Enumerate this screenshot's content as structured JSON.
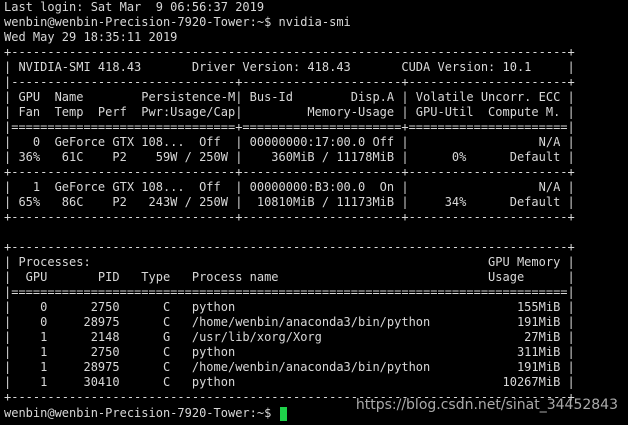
{
  "terminal": {
    "lines": [
      "Last login: Sat Mar  9 06:56:37 2019",
      "wenbin@wenbin-Precision-7920-Tower:~$ nvidia-smi",
      "Wed May 29 18:35:11 2019",
      "+-----------------------------------------------------------------------------+",
      "| NVIDIA-SMI 418.43       Driver Version: 418.43       CUDA Version: 10.1     |",
      "|-------------------------------+----------------------+----------------------+",
      "| GPU  Name        Persistence-M| Bus-Id        Disp.A | Volatile Uncorr. ECC |",
      "| Fan  Temp  Perf  Pwr:Usage/Cap|         Memory-Usage | GPU-Util  Compute M. |",
      "|===============================+======================+======================|",
      "|   0  GeForce GTX 108...  Off  | 00000000:17:00.0 Off |                  N/A |",
      "| 36%   61C    P2    59W / 250W |    360MiB / 11178MiB |      0%      Default |",
      "+-------------------------------+----------------------+----------------------+",
      "|   1  GeForce GTX 108...  Off  | 00000000:B3:00.0  On |                  N/A |",
      "| 65%   86C    P2   243W / 250W |  10810MiB / 11173MiB |     34%      Default |",
      "+-------------------------------+----------------------+----------------------+",
      "",
      "+-----------------------------------------------------------------------------+",
      "| Processes:                                                       GPU Memory |",
      "|  GPU       PID   Type   Process name                             Usage      |",
      "|=============================================================================|",
      "|    0      2750      C   python                                       155MiB |",
      "|    0     28975      C   /home/wenbin/anaconda3/bin/python            191MiB |",
      "|    1      2148      G   /usr/lib/xorg/Xorg                            27MiB |",
      "|    1      2750      C   python                                       311MiB |",
      "|    1     28975      C   /home/wenbin/anaconda3/bin/python            191MiB |",
      "|    1     30410      C   python                                     10267MiB |",
      "+-----------------------------------------------------------------------------+"
    ],
    "prompt": "wenbin@wenbin-Precision-7920-Tower:~$ "
  },
  "watermark": {
    "text": "https://blog.csdn.net/sinat_34452843"
  },
  "colors": {
    "background": "#000000",
    "text": "#d8d8d8",
    "cursor": "#1ed24a"
  }
}
